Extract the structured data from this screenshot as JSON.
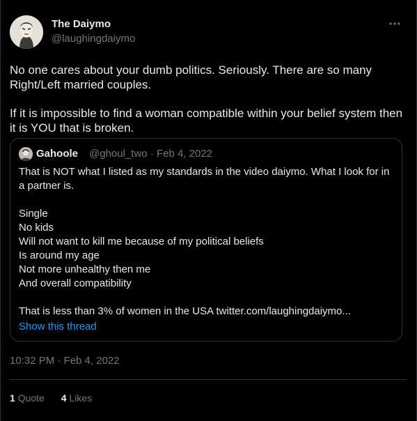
{
  "author": {
    "name": "The Daiymo",
    "handle": "@laughingdaiymo"
  },
  "tweet": {
    "paragraphs": [
      "No one cares about your dumb politics. Seriously. There are so many Right/Left married couples.",
      "If it is impossible to find a woman compatible within your belief system then it is YOU that is broken."
    ]
  },
  "quoted": {
    "name": "Gahoole",
    "meta": "@ghoul_two · Feb 4, 2022",
    "intro": "That is NOT what I listed as my standards in the video daiymo. What I look for in a partner is.",
    "list": [
      "Single",
      "No kids",
      "Will not want to kill me because of my political beliefs",
      "Is around my age",
      "Not more unhealthy then me",
      "And overall compatibility"
    ],
    "closing": "That is less than 3% of women in the USA twitter.com/laughingdaiymo...",
    "show_thread": "Show this thread"
  },
  "timestamp": "10:32 PM · Feb 4, 2022",
  "stats": {
    "quotes_count": "1",
    "quotes_label": "Quote",
    "likes_count": "4",
    "likes_label": "Likes"
  },
  "colors": {
    "background": "#000000",
    "text": "#e7e9ea",
    "secondary": "#71767b",
    "link": "#1d9bf0",
    "border": "#2f3336"
  },
  "icons": {
    "more": "more-horizontal-icon"
  }
}
